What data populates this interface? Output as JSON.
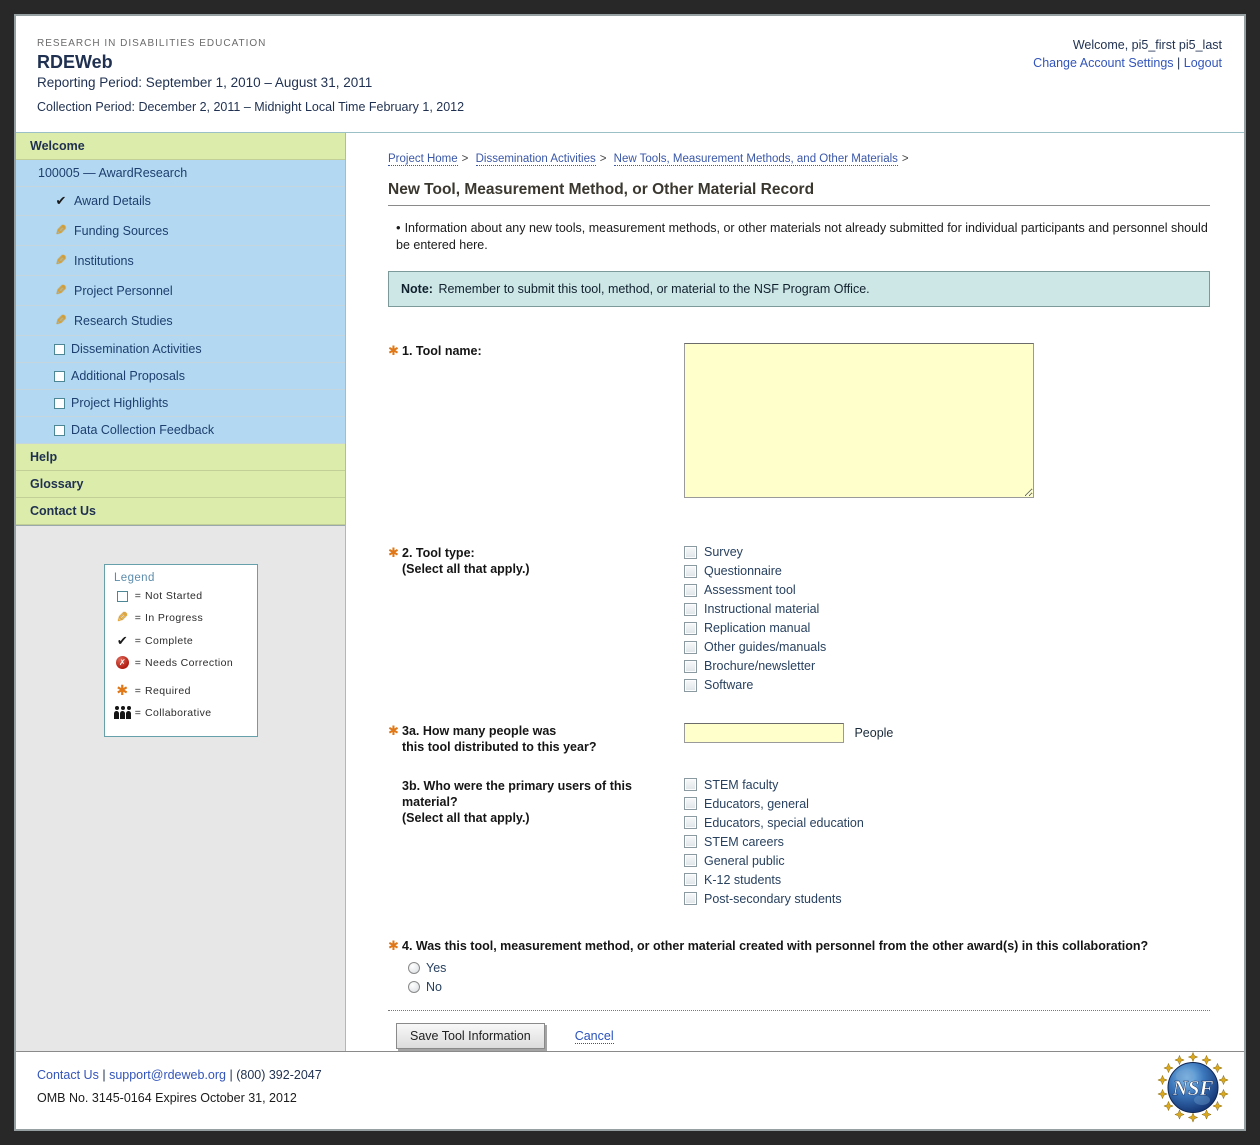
{
  "symbols": {
    "required_star": "✱",
    "bullet": "•",
    "equals": "=",
    "pipe": "|",
    "crumb_arrow": ">"
  },
  "header": {
    "eyebrow": "RESEARCH IN DISABILITIES EDUCATION",
    "app_name": "RDEWeb",
    "reporting_period": "Reporting Period: September 1, 2010 – August 31, 2011",
    "collection_period": "Collection Period: December 2, 2011 – Midnight Local Time February 1, 2012",
    "welcome_user": "Welcome, pi5_first pi5_last",
    "account_settings_label": "Change Account Settings",
    "logout_label": "Logout"
  },
  "sidebar": {
    "welcome_header": "Welcome",
    "award_label": "100005 — AwardResearch",
    "items": [
      {
        "icon": "complete",
        "label": "Award Details"
      },
      {
        "icon": "in-progress",
        "label": "Funding Sources"
      },
      {
        "icon": "in-progress",
        "label": "Institutions"
      },
      {
        "icon": "in-progress",
        "label": "Project Personnel"
      },
      {
        "icon": "in-progress",
        "label": "Research Studies"
      },
      {
        "icon": "not-started",
        "label": "Dissemination Activities"
      },
      {
        "icon": "not-started",
        "label": "Additional Proposals"
      },
      {
        "icon": "not-started",
        "label": "Project Highlights"
      },
      {
        "icon": "not-started",
        "label": "Data Collection Feedback"
      }
    ],
    "help_header": "Help",
    "glossary_header": "Glossary",
    "contact_header": "Contact Us"
  },
  "legend": {
    "title": "Legend",
    "rows": [
      {
        "icon": "not-started",
        "label": "Not Started"
      },
      {
        "icon": "in-progress",
        "label": "In Progress"
      },
      {
        "icon": "complete",
        "label": "Complete"
      },
      {
        "icon": "needs-correction",
        "label": "Needs Correction"
      },
      {
        "icon": "required",
        "label": "Required"
      },
      {
        "icon": "collaborative",
        "label": "Collaborative"
      }
    ],
    "needs_correction_glyph": "✗"
  },
  "breadcrumb": [
    {
      "label": "Project Home",
      "sep": ">"
    },
    {
      "label": "Dissemination Activities",
      "sep": ">"
    },
    {
      "label": "New Tools, Measurement Methods, and Other Materials",
      "sep": ">"
    }
  ],
  "main": {
    "title": "New Tool, Measurement Method, or Other Material Record",
    "intro": "Information about any new tools, measurement methods, or other materials not already submitted for individual participants and personnel should be entered here.",
    "note_label": "Note:",
    "note_text": "Remember to submit this tool, method, or material to the NSF Program Office.",
    "q1": {
      "label": "1. Tool name:",
      "value": ""
    },
    "q2": {
      "label": "2. Tool type:",
      "sublabel": "(Select all that apply.)",
      "options": [
        "Survey",
        "Questionnaire",
        "Assessment tool",
        "Instructional material",
        "Replication manual",
        "Other guides/manuals",
        "Brochure/newsletter",
        "Software"
      ]
    },
    "q3a": {
      "label_line1": "3a. How many people was",
      "label_line2": "this tool distributed to this year?",
      "value": "",
      "unit": "People"
    },
    "q3b": {
      "label_line1": "3b. Who were the primary users of this material?",
      "sublabel": "(Select all that apply.)",
      "options": [
        "STEM faculty",
        "Educators, general",
        "Educators, special education",
        "STEM careers",
        "General public",
        "K-12 students",
        "Post-secondary students"
      ]
    },
    "q4": {
      "label": "4. Was this tool, measurement method, or other material created with personnel from the other award(s) in this collaboration?",
      "options": [
        "Yes",
        "No"
      ]
    },
    "save_button_label": "Save Tool Information",
    "cancel_label": "Cancel"
  },
  "footer": {
    "contact_label": "Contact Us",
    "email": "support@rdeweb.org",
    "phone": "(800) 392-2047",
    "omb": "OMB No. 3145-0164 Expires October 31, 2012",
    "nsf_text": "NSF"
  },
  "colors": {
    "accent_orange": "#e07818",
    "sidebar_green": "#dcecab",
    "sidebar_blue": "#b3d9f2",
    "note_bg": "#cde6e6",
    "field_yellow": "#ffffcc",
    "link_blue": "#3355bb",
    "navy_text": "#1f3050"
  }
}
